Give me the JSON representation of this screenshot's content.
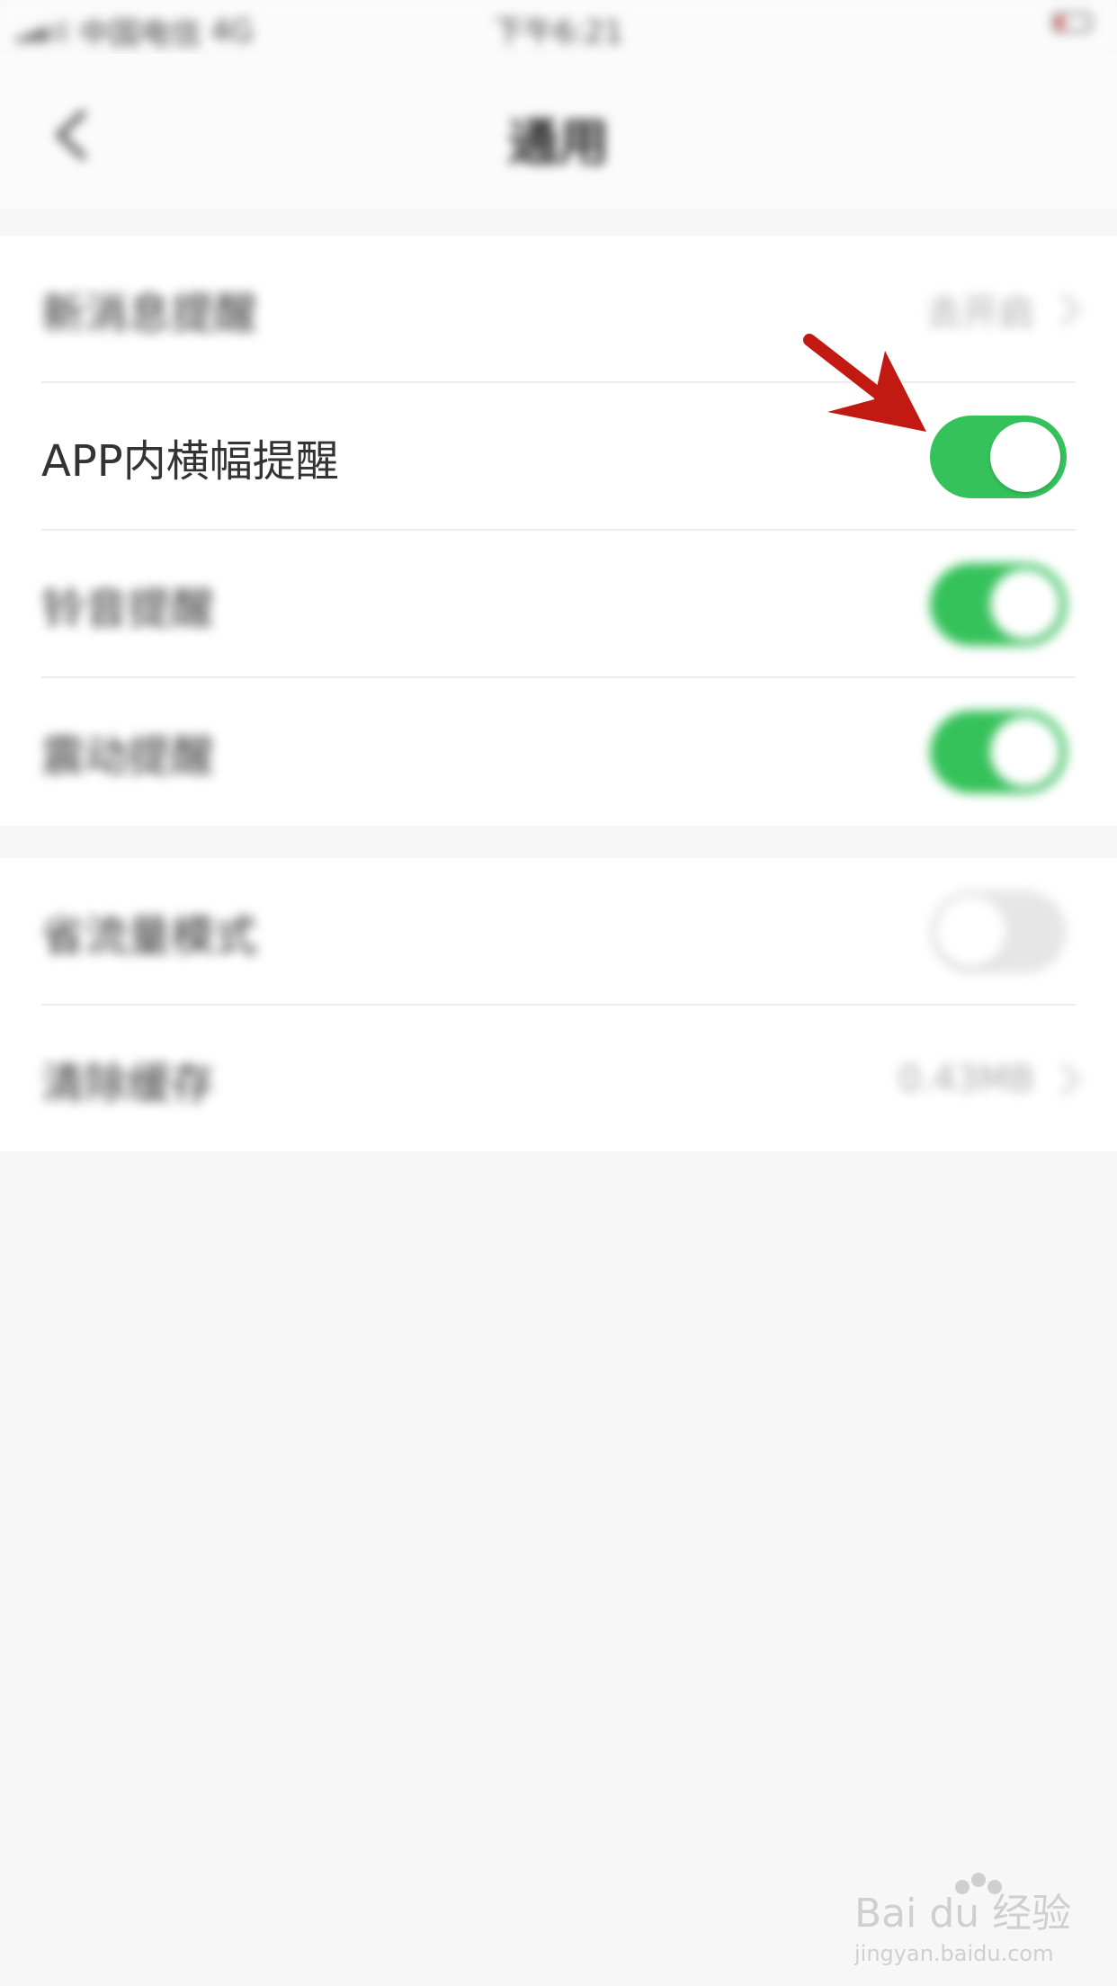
{
  "status_bar": {
    "carrier": "中国电信",
    "network": "4G",
    "time": "下午6:21"
  },
  "nav": {
    "title": "通用",
    "back_icon": "chevron-left-icon"
  },
  "settings": {
    "group1": [
      {
        "label": "新消息提醒",
        "value": "去开启",
        "control": "chevron"
      },
      {
        "label": "APP内横幅提醒",
        "control": "toggle",
        "on": true
      },
      {
        "label": "铃音提醒",
        "control": "toggle",
        "on": true
      },
      {
        "label": "震动提醒",
        "control": "toggle",
        "on": true
      }
    ],
    "group2": [
      {
        "label": "省流量模式",
        "control": "toggle",
        "on": false
      },
      {
        "label": "清除缓存",
        "value": "0.43MB",
        "control": "chevron"
      }
    ]
  },
  "colors": {
    "toggle_on": "#35c25a",
    "toggle_off": "#e6e6e6",
    "arrow": "#c21a12",
    "background": "#f7f7f7"
  },
  "watermark": {
    "brand": "Bai du 经验",
    "url": "jingyan.baidu.com"
  }
}
